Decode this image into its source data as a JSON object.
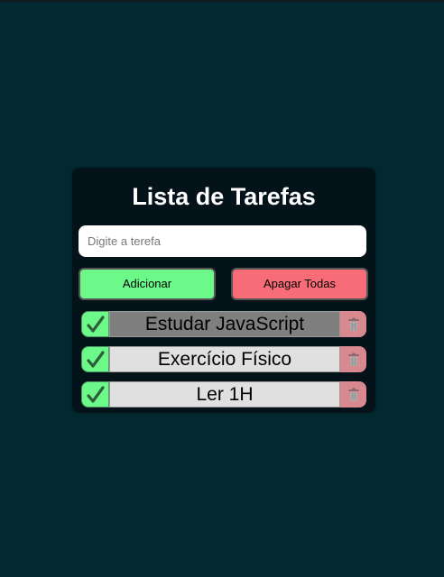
{
  "app": {
    "title": "Lista de Tarefas"
  },
  "input": {
    "placeholder": "Digite a terefa",
    "value": ""
  },
  "buttons": {
    "add_label": "Adicionar",
    "clear_label": "Apagar Todas"
  },
  "tasks": [
    {
      "text": "Estudar JavaScript",
      "highlighted": true,
      "check_icon": "checkmark-icon",
      "delete_icon": "trash-icon"
    },
    {
      "text": "Exercício Físico",
      "highlighted": false,
      "check_icon": "checkmark-icon",
      "delete_icon": "trash-icon"
    },
    {
      "text": "Ler 1H",
      "highlighted": false,
      "check_icon": "checkmark-icon",
      "delete_icon": "trash-icon"
    }
  ],
  "colors": {
    "page_background": "#022930",
    "card_background": "#04121a",
    "add_button": "#6cf98a",
    "clear_button": "#f76c77",
    "task_check": "#6cf98a",
    "task_delete": "#d8888f",
    "task_text_background": "#e0e0e0",
    "task_text_highlighted": "#7f7f7f"
  }
}
